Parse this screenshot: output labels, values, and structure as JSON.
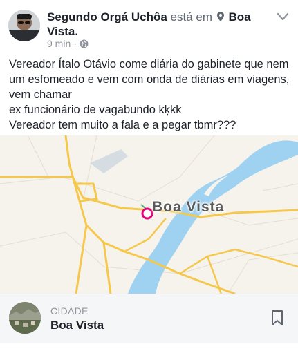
{
  "post": {
    "author_name": "Segundo Orgá Uchôa",
    "verb": "está em",
    "place_name": "Boa Vista.",
    "timestamp": "9 min",
    "separator": "·",
    "privacy_icon": "globe-icon",
    "menu_icon": "chevron-down-icon",
    "body": "Vereador Ítalo Otávio come diária do gabinete que nem um esfomeado e vem com onda de diárias em viagens,  vem chamar\n ex funcionário de vagabundo kķkk\nVereador tem muito a fala e a pegar tbmr???"
  },
  "map": {
    "label": "Boa Vista",
    "pin_color": "#e4007c",
    "river_color": "#9fd2f0",
    "road_color": "#f5c84c"
  },
  "place_card": {
    "category": "CIDADE",
    "name": "Boa Vista",
    "save_icon": "bookmark-icon"
  }
}
